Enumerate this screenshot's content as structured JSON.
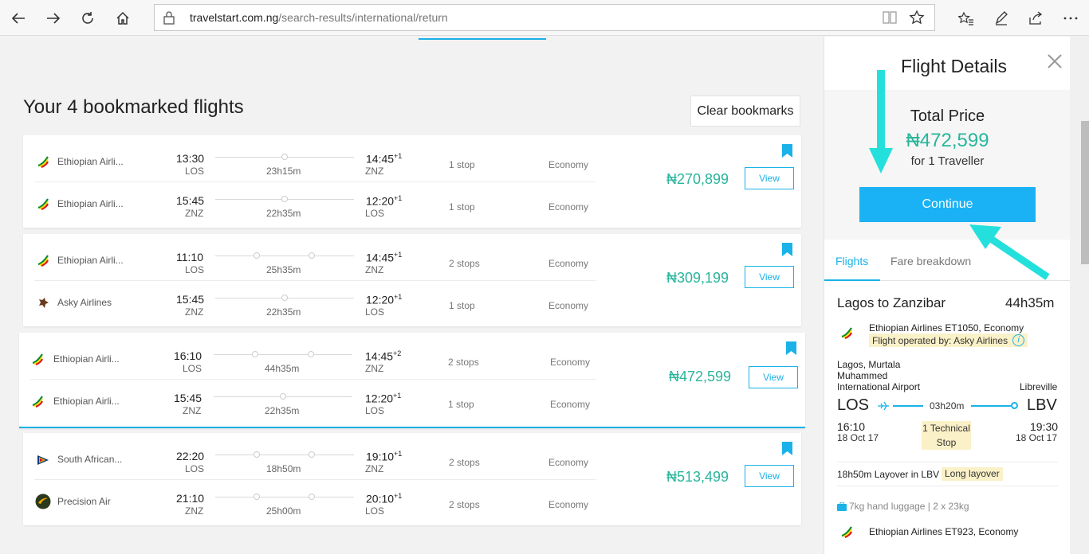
{
  "browser": {
    "url_host": "travelstart.com.ng",
    "url_path": "/search-results/international/return"
  },
  "page": {
    "title": "Your 4 bookmarked flights",
    "clear_label": "Clear bookmarks"
  },
  "cards": [
    {
      "price": "₦270,899",
      "view": "View",
      "legs": [
        {
          "airline": "Ethiopian Airli...",
          "dep_time": "13:30",
          "dep": "LOS",
          "dur": "23h15m",
          "arr_time": "14:45",
          "day": "+1",
          "arr": "ZNZ",
          "stops": "1 stop",
          "cabin": "Economy"
        },
        {
          "airline": "Ethiopian Airli...",
          "dep_time": "15:45",
          "dep": "ZNZ",
          "dur": "22h35m",
          "arr_time": "12:20",
          "day": "+1",
          "arr": "LOS",
          "stops": "1 stop",
          "cabin": "Economy"
        }
      ]
    },
    {
      "price": "₦309,199",
      "view": "View",
      "legs": [
        {
          "airline": "Ethiopian Airli...",
          "dep_time": "11:10",
          "dep": "LOS",
          "dur": "25h35m",
          "arr_time": "14:45",
          "day": "+1",
          "arr": "ZNZ",
          "stops": "2 stops",
          "cabin": "Economy"
        },
        {
          "airline": "Asky Airlines",
          "dep_time": "15:45",
          "dep": "ZNZ",
          "dur": "22h35m",
          "arr_time": "12:20",
          "day": "+1",
          "arr": "LOS",
          "stops": "1 stop",
          "cabin": "Economy"
        }
      ]
    },
    {
      "price": "₦472,599",
      "view": "View",
      "legs": [
        {
          "airline": "Ethiopian Airli...",
          "dep_time": "16:10",
          "dep": "LOS",
          "dur": "44h35m",
          "arr_time": "14:45",
          "day": "+2",
          "arr": "ZNZ",
          "stops": "2 stops",
          "cabin": "Economy"
        },
        {
          "airline": "Ethiopian Airli...",
          "dep_time": "15:45",
          "dep": "ZNZ",
          "dur": "22h35m",
          "arr_time": "12:20",
          "day": "+1",
          "arr": "LOS",
          "stops": "1 stop",
          "cabin": "Economy"
        }
      ]
    },
    {
      "price": "₦513,499",
      "view": "View",
      "legs": [
        {
          "airline": "South African...",
          "dep_time": "22:20",
          "dep": "LOS",
          "dur": "18h50m",
          "arr_time": "19:10",
          "day": "+1",
          "arr": "ZNZ",
          "stops": "2 stops",
          "cabin": "Economy"
        },
        {
          "airline": "Precision Air",
          "dep_time": "21:10",
          "dep": "ZNZ",
          "dur": "25h00m",
          "arr_time": "20:10",
          "day": "+1",
          "arr": "LOS",
          "stops": "2 stops",
          "cabin": "Economy"
        }
      ]
    }
  ],
  "panel": {
    "title": "Flight Details",
    "total_label": "Total Price",
    "total_value": "₦472,599",
    "for_label": "for 1 Traveller",
    "continue_label": "Continue",
    "tab_flights": "Flights",
    "tab_fare": "Fare breakdown",
    "route": "Lagos to Zanzibar",
    "route_duration": "44h35m",
    "segment": {
      "airline": "Ethiopian Airlines ET1050, Economy",
      "operated_by": "Flight operated by: Asky Airlines",
      "dep_name": "Lagos, Murtala Muhammed International Airport",
      "arr_name": "Libreville",
      "dep_code": "LOS",
      "arr_code": "LBV",
      "duration": "03h20m",
      "dep_time": "16:10",
      "dep_date": "18 Oct 17",
      "arr_time": "19:30",
      "arr_date": "18 Oct 17",
      "tech_stop": "1 Technical Stop"
    },
    "layover": "18h50m Layover in LBV",
    "long_layover": "Long layover",
    "luggage": "7kg hand luggage | 2 x 23kg",
    "next_segment": "Ethiopian Airlines ET923, Economy"
  },
  "colors": {
    "accent": "#1ab2e8",
    "price": "#2ab59b",
    "annotation_arrow": "#24e0dc"
  }
}
